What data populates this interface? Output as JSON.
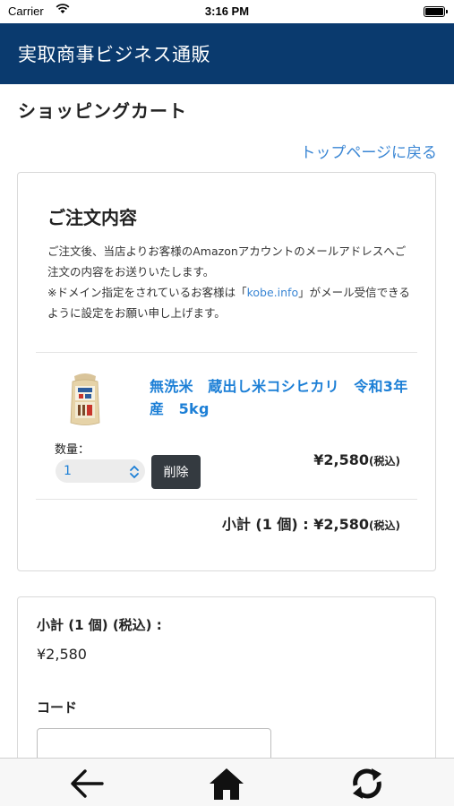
{
  "status": {
    "carrier": "Carrier",
    "time": "3:16 PM"
  },
  "header": {
    "title": "実取商事ビジネス通販"
  },
  "page": {
    "title": "ショッピングカート",
    "top_link": "トップページに戻る"
  },
  "order": {
    "heading": "ご注文内容",
    "notice_1": "ご注文後、当店よりお客様のAmazonアカウントのメールアドレスへご注文の内容をお送りいたします。",
    "notice_2_pre": "※ドメイン指定をされているお客様は「",
    "notice_2_domain": "kobe.info",
    "notice_2_post": "」がメール受信できるように設定をお願い申し上げます。",
    "item": {
      "name": "無洗米　蔵出し米コシヒカリ　令和3年産　5kg",
      "qty_label": "数量：",
      "qty_value": "1",
      "delete_label": "削除",
      "price": "¥2,580",
      "price_tax": "(税込)"
    },
    "subtotal": "小計 (1 個) : ¥2,580",
    "subtotal_tax": "(税込)"
  },
  "summary": {
    "label": "小計 (1 個) (税込) :",
    "amount": "¥2,580",
    "code_label": "コード",
    "code_value": ""
  },
  "toolbar": {
    "back_icon": "back-arrow-icon",
    "home_icon": "home-icon",
    "reload_icon": "reload-icon"
  }
}
